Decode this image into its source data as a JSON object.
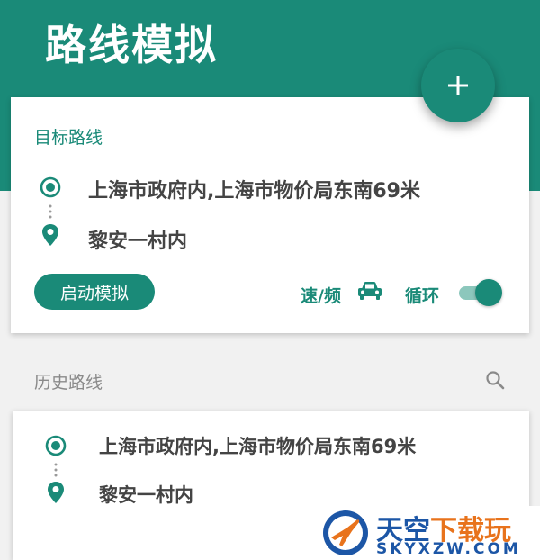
{
  "header": {
    "title": "路线模拟",
    "add_icon": "plus-icon"
  },
  "target_route": {
    "title": "目标路线",
    "origin": "上海市政府内,上海市物价局东南69米",
    "destination": "黎安一村内",
    "origin_icon": "origin-target-icon",
    "destination_icon": "location-pin-icon",
    "start_button_label": "启动模拟",
    "speed_label": "速/频",
    "speed_icon": "car-icon",
    "loop_label": "循环",
    "loop_enabled": true
  },
  "history": {
    "title": "历史路线",
    "search_icon": "search-icon",
    "items": [
      {
        "origin": "上海市政府内,上海市物价局东南69米",
        "destination": "黎安一村内"
      }
    ]
  },
  "watermark": {
    "name_main": "天空",
    "name_accent": "下载玩",
    "domain": "SKYXZW.COM"
  },
  "colors": {
    "primary": "#1a8a78",
    "background": "#f1f1f1",
    "card": "#ffffff",
    "text": "#444444",
    "muted": "#8a8a8a",
    "toggle_track": "#8cc7bc"
  }
}
